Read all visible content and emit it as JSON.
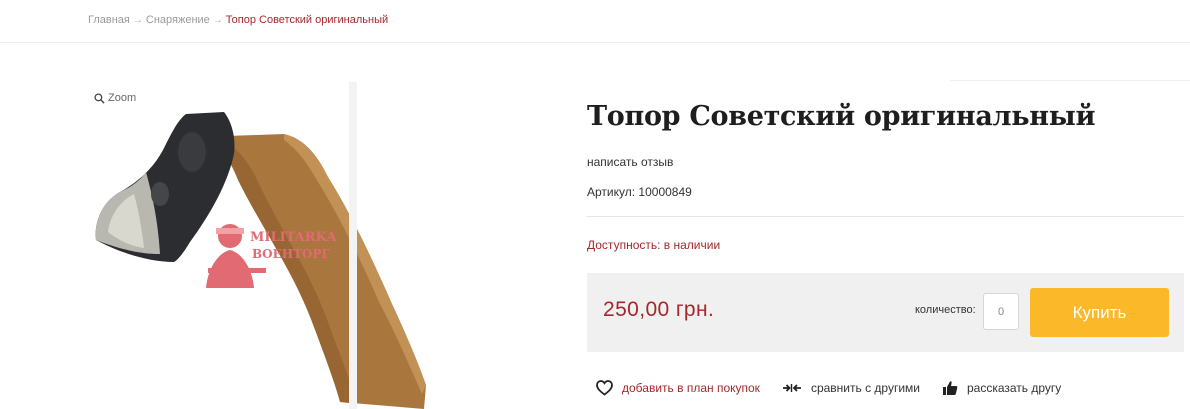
{
  "breadcrumb": {
    "items": [
      "Главная",
      "Снаряжение"
    ],
    "separator": "→",
    "current": "Топор Советский оригинальный"
  },
  "image": {
    "zoom_label": "Zoom",
    "watermark_line1": "MILITARKA",
    "watermark_line2": "ВОЕНТОРГ"
  },
  "product": {
    "title": "Топор Советский оригинальный",
    "review_link": "написать отзыв",
    "sku_label": "Артикул:",
    "sku_value": "10000849",
    "availability_label": "Доступность:",
    "availability_value": "в наличии"
  },
  "buy": {
    "price": "250,00 грн.",
    "quantity_label": "количество:",
    "quantity_value": "0",
    "buy_label": "Купить"
  },
  "actions": {
    "wishlist": "добавить в план покупок",
    "compare": "сравнить с другими",
    "share": "рассказать другу"
  },
  "colors": {
    "accent_red": "#a4282c",
    "buy_button": "#fbb829",
    "panel_bg": "#f0f0f0"
  },
  "icons": [
    "search-icon",
    "heart-icon",
    "compare-arrows-icon",
    "thumbs-up-icon"
  ]
}
